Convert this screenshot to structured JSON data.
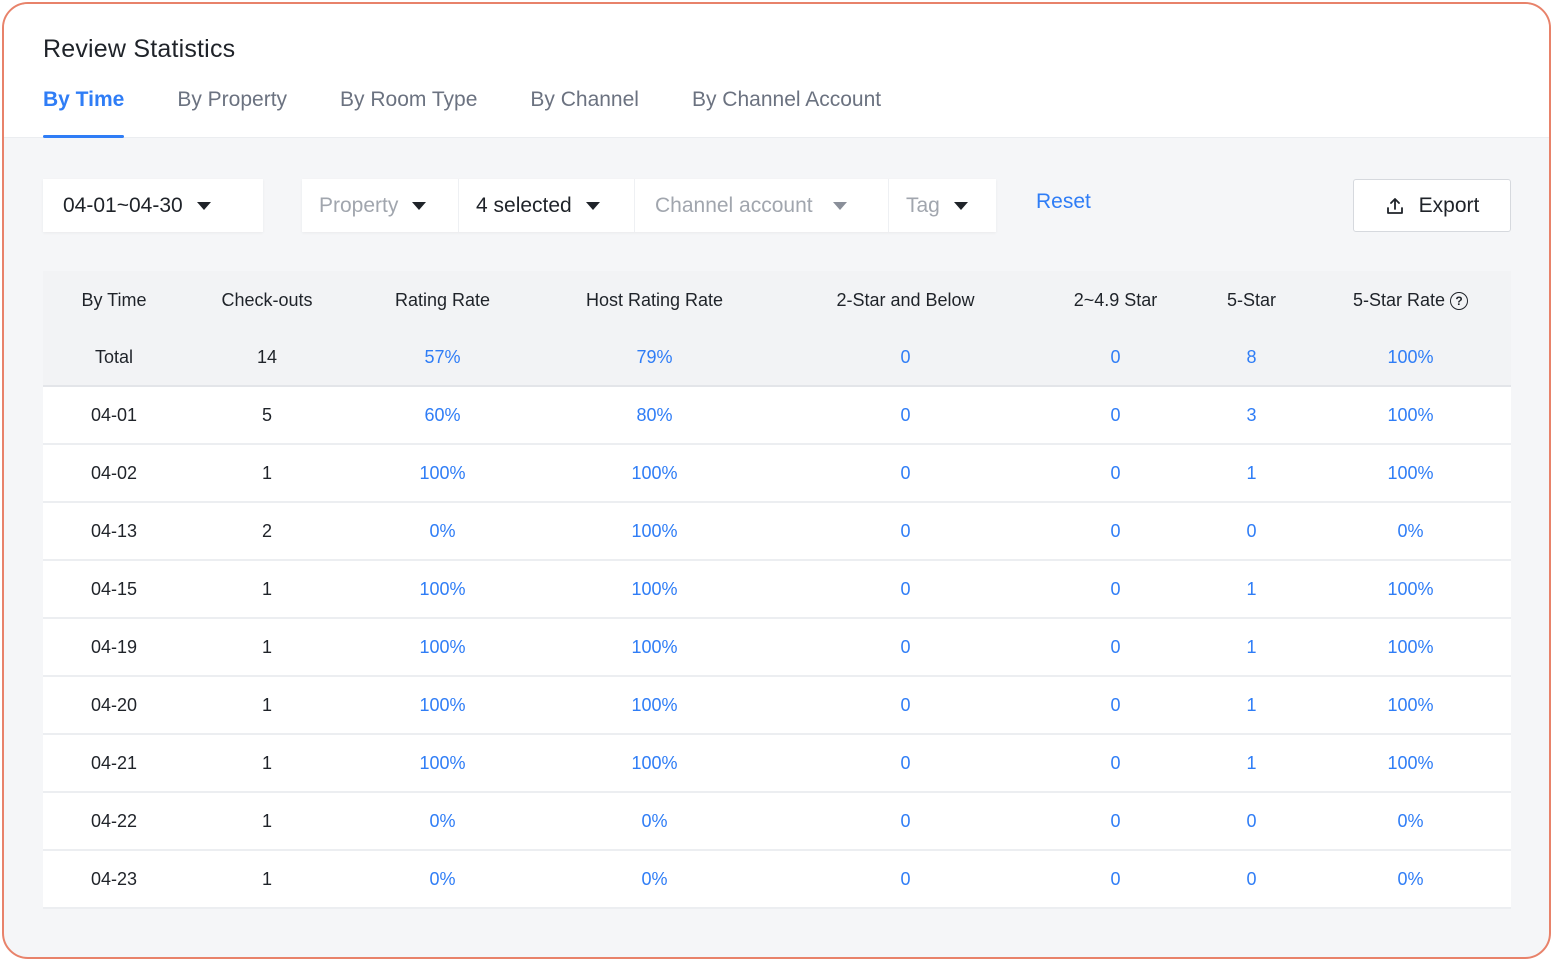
{
  "page_title": "Review Statistics",
  "tabs": [
    {
      "label": "By Time",
      "active": true
    },
    {
      "label": "By Property"
    },
    {
      "label": "By Room Type"
    },
    {
      "label": "By Channel"
    },
    {
      "label": "By Channel Account"
    }
  ],
  "filters": {
    "date_range": "04-01~04-30",
    "property_placeholder": "Property",
    "selected_value": "4 selected",
    "channel_account_placeholder": "Channel account",
    "tag_placeholder": "Tag",
    "reset_label": "Reset",
    "export_label": "Export"
  },
  "table": {
    "columns": [
      "By Time",
      "Check-outs",
      "Rating Rate",
      "Host Rating Rate",
      "2-Star and Below",
      "2~4.9 Star",
      "5-Star",
      "5-Star Rate"
    ],
    "total": [
      "Total",
      "14",
      "57%",
      "79%",
      "0",
      "0",
      "8",
      "100%"
    ],
    "rows": [
      [
        "04-01",
        "5",
        "60%",
        "80%",
        "0",
        "0",
        "3",
        "100%"
      ],
      [
        "04-02",
        "1",
        "100%",
        "100%",
        "0",
        "0",
        "1",
        "100%"
      ],
      [
        "04-13",
        "2",
        "0%",
        "100%",
        "0",
        "0",
        "0",
        "0%"
      ],
      [
        "04-15",
        "1",
        "100%",
        "100%",
        "0",
        "0",
        "1",
        "100%"
      ],
      [
        "04-19",
        "1",
        "100%",
        "100%",
        "0",
        "0",
        "1",
        "100%"
      ],
      [
        "04-20",
        "1",
        "100%",
        "100%",
        "0",
        "0",
        "1",
        "100%"
      ],
      [
        "04-21",
        "1",
        "100%",
        "100%",
        "0",
        "0",
        "1",
        "100%"
      ],
      [
        "04-22",
        "1",
        "0%",
        "0%",
        "0",
        "0",
        "0",
        "0%"
      ],
      [
        "04-23",
        "1",
        "0%",
        "0%",
        "0",
        "0",
        "0",
        "0%"
      ]
    ]
  },
  "colors": {
    "accent": "#2f7df6",
    "frame_border": "#e8826a"
  },
  "icons": {
    "export": "upload-icon",
    "help": "question-circle-icon",
    "dropdown": "caret-down-icon"
  }
}
